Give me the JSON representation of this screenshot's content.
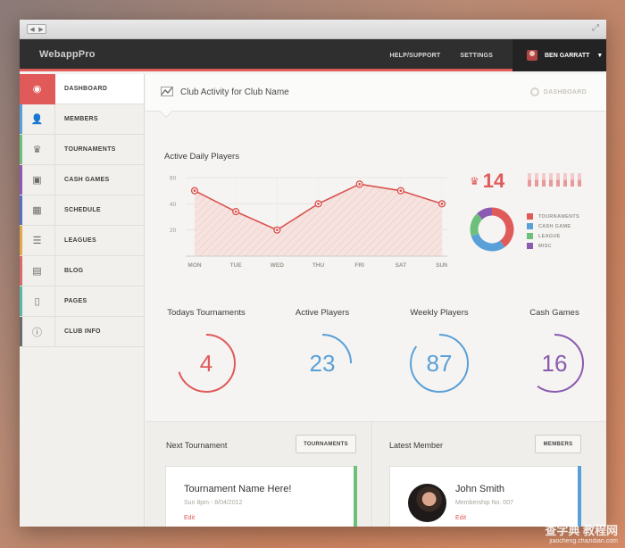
{
  "app": {
    "brand": "WebappPro"
  },
  "topnav": {
    "help": "HELP/SUPPORT",
    "settings": "SETTINGS",
    "user": "BEN GARRATT",
    "caret": "▼"
  },
  "sidebar": {
    "items": [
      {
        "label": "DASHBOARD",
        "icon": "dashboard-icon",
        "color": "#e05a5a",
        "active": true
      },
      {
        "label": "MEMBERS",
        "icon": "user-icon",
        "color": "#5aa0d8"
      },
      {
        "label": "TOURNAMENTS",
        "icon": "crown-icon",
        "color": "#6cc07a"
      },
      {
        "label": "CASH GAMES",
        "icon": "wallet-icon",
        "color": "#8a5bb0"
      },
      {
        "label": "SCHEDULE",
        "icon": "calendar-icon",
        "color": "#5a6fc0"
      },
      {
        "label": "LEAGUES",
        "icon": "list-icon",
        "color": "#e2a74a"
      },
      {
        "label": "BLOG",
        "icon": "chat-icon",
        "color": "#d86a6a"
      },
      {
        "label": "PAGES",
        "icon": "page-icon",
        "color": "#5ab8a8"
      },
      {
        "label": "CLUB INFO",
        "icon": "info-icon",
        "color": "#6b6b6b"
      }
    ]
  },
  "header": {
    "title": "Club Activity for Club Name",
    "crumb": "DASHBOARD"
  },
  "activity": {
    "title": "Active Daily Players"
  },
  "chart_data": {
    "type": "area",
    "title": "Active Daily Players",
    "categories": [
      "MON",
      "TUE",
      "WED",
      "THU",
      "FRI",
      "SAT",
      "SUN"
    ],
    "values": [
      50,
      34,
      20,
      40,
      55,
      50,
      40
    ],
    "yticks": [
      20,
      40,
      60
    ],
    "ylim": [
      0,
      60
    ],
    "grid": true,
    "color": "#d9534f"
  },
  "crown_stat": {
    "value": "14",
    "bars": [
      0.5,
      0.5,
      0.5,
      0.5,
      0.5,
      0.5,
      0.5,
      0.5
    ]
  },
  "donut": {
    "slices": [
      {
        "name": "TOURNAMENTS",
        "value": 40,
        "color": "#e05a5a"
      },
      {
        "name": "CASH GAME",
        "value": 30,
        "color": "#5aa0d8"
      },
      {
        "name": "LEAGUE",
        "value": 18,
        "color": "#6cc07a"
      },
      {
        "name": "MISC",
        "value": 12,
        "color": "#8a5bb0"
      }
    ]
  },
  "stats": [
    {
      "label": "Todays Tournaments",
      "value": "4",
      "color": "#e05a5a",
      "fraction": 0.7
    },
    {
      "label": "Active Players",
      "value": "23",
      "color": "#5aa0d8",
      "fraction": 0.25
    },
    {
      "label": "Weekly Players",
      "value": "87",
      "color": "#5aa0d8",
      "fraction": 0.85
    },
    {
      "label": "Cash Games",
      "value": "16",
      "color": "#8a5bb0",
      "fraction": 0.6
    }
  ],
  "next_tournament": {
    "title": "Next Tournament",
    "button": "TOURNAMENTS",
    "card_title": "Tournament Name Here!",
    "card_sub": "Sun 8pm - 8/04/2012",
    "edit": "Edit",
    "accent": "#6cc07a"
  },
  "latest_member": {
    "title": "Latest Member",
    "button": "MEMBERS",
    "card_title": "John Smith",
    "card_sub": "Membership No. 007",
    "edit": "Edit",
    "accent": "#5aa0d8"
  },
  "watermark": {
    "line1": "查字典 教程网",
    "line2": "jiaocheng.chazidian.com"
  }
}
